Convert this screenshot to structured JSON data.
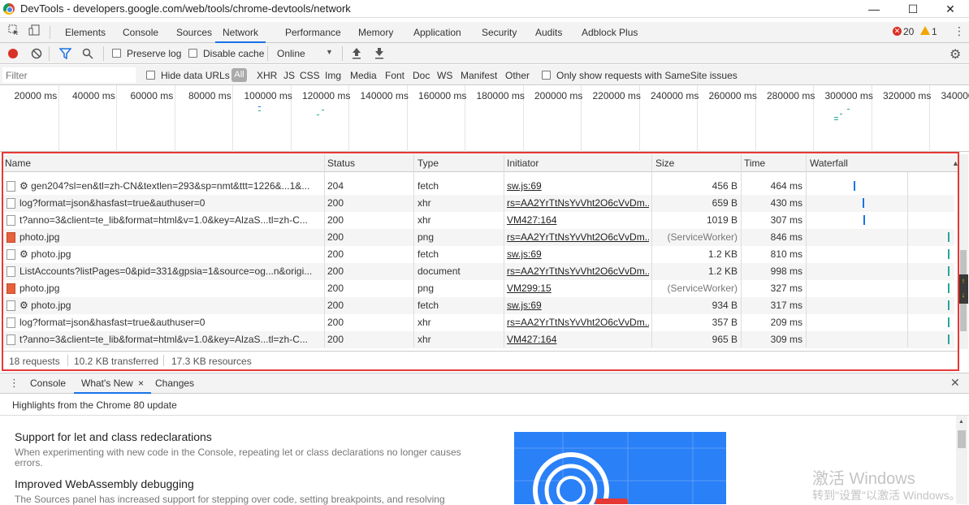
{
  "window": {
    "title": "DevTools - developers.google.com/web/tools/chrome-devtools/network",
    "minimize": "—",
    "maximize": "☐",
    "close": "✕"
  },
  "tabs": [
    "Elements",
    "Console",
    "Sources",
    "Network",
    "Performance",
    "Memory",
    "Application",
    "Security",
    "Audits",
    "Adblock Plus"
  ],
  "active_tab": "Network",
  "status": {
    "errors": "20",
    "warnings": "1"
  },
  "toolbar": {
    "preserve_log": "Preserve log",
    "disable_cache": "Disable cache",
    "throttle": "Online"
  },
  "filterbar": {
    "placeholder": "Filter",
    "hide_data_urls": "Hide data URLs",
    "all": "All",
    "types": [
      "XHR",
      "JS",
      "CSS",
      "Img",
      "Media",
      "Font",
      "Doc",
      "WS",
      "Manifest",
      "Other"
    ],
    "samesite": "Only show requests with SameSite issues"
  },
  "overview": {
    "ticks": [
      "20000 ms",
      "40000 ms",
      "60000 ms",
      "80000 ms",
      "100000 ms",
      "120000 ms",
      "140000 ms",
      "160000 ms",
      "180000 ms",
      "200000 ms",
      "220000 ms",
      "240000 ms",
      "260000 ms",
      "280000 ms",
      "300000 ms",
      "320000 ms",
      "340000"
    ]
  },
  "grid": {
    "columns": [
      "Name",
      "Status",
      "Type",
      "Initiator",
      "Size",
      "Time",
      "Waterfall"
    ],
    "rows": [
      {
        "name": "⚙ gen204?sl=en&tl=zh-CN&textlen=293&sp=nmt&ttt=1226&...1&...",
        "status": "204",
        "type": "fetch",
        "initiator": "sw.js:69",
        "size": "456 B",
        "time": "464 ms",
        "icon": "doc",
        "wf": 0.32
      },
      {
        "name": "log?format=json&hasfast=true&authuser=0",
        "status": "200",
        "type": "xhr",
        "initiator": "rs=AA2YrTtNsYvVht2O6cVvDm...",
        "size": "659 B",
        "time": "430 ms",
        "icon": "doc",
        "wf": 0.38
      },
      {
        "name": "t?anno=3&client=te_lib&format=html&v=1.0&key=AlzaS...tl=zh-C...",
        "status": "200",
        "type": "xhr",
        "initiator": "VM427:164",
        "size": "1019 B",
        "time": "307 ms",
        "icon": "doc",
        "wf": 0.39
      },
      {
        "name": "photo.jpg",
        "status": "200",
        "type": "png",
        "initiator": "rs=AA2YrTtNsYvVht2O6cVvDm...",
        "size": "(ServiceWorker)",
        "time": "846 ms",
        "icon": "img",
        "wf": 0.98
      },
      {
        "name": "⚙ photo.jpg",
        "status": "200",
        "type": "fetch",
        "initiator": "sw.js:69",
        "size": "1.2 KB",
        "time": "810 ms",
        "icon": "doc",
        "wf": 0.98
      },
      {
        "name": "ListAccounts?listPages=0&pid=331&gpsia=1&source=og...n&origi...",
        "status": "200",
        "type": "document",
        "initiator": "rs=AA2YrTtNsYvVht2O6cVvDm...",
        "size": "1.2 KB",
        "time": "998 ms",
        "icon": "doc",
        "wf": 0.98
      },
      {
        "name": "photo.jpg",
        "status": "200",
        "type": "png",
        "initiator": "VM299:15",
        "size": "(ServiceWorker)",
        "time": "327 ms",
        "icon": "img",
        "wf": 0.98
      },
      {
        "name": "⚙ photo.jpg",
        "status": "200",
        "type": "fetch",
        "initiator": "sw.js:69",
        "size": "934 B",
        "time": "317 ms",
        "icon": "doc",
        "wf": 0.98
      },
      {
        "name": "log?format=json&hasfast=true&authuser=0",
        "status": "200",
        "type": "xhr",
        "initiator": "rs=AA2YrTtNsYvVht2O6cVvDm...",
        "size": "357 B",
        "time": "209 ms",
        "icon": "doc",
        "wf": 0.98
      },
      {
        "name": "t?anno=3&client=te_lib&format=html&v=1.0&key=AlzaS...tl=zh-C...",
        "status": "200",
        "type": "xhr",
        "initiator": "VM427:164",
        "size": "965 B",
        "time": "309 ms",
        "icon": "doc",
        "wf": 0.98
      }
    ]
  },
  "summary": {
    "requests": "18 requests",
    "transferred": "10.2 KB transferred",
    "resources": "17.3 KB resources"
  },
  "drawer": {
    "tabs": [
      "Console",
      "What's New",
      "Changes"
    ],
    "active": "What's New",
    "close_tab": "×",
    "close": "✕"
  },
  "whatsnew": {
    "header": "Highlights from the Chrome 80 update",
    "items": [
      {
        "title": "Support for let and class redeclarations",
        "desc": "When experimenting with new code in the Console, repeating let or class declarations no longer causes errors."
      },
      {
        "title": "Improved WebAssembly debugging",
        "desc": "The Sources panel has increased support for stepping over code, setting breakpoints, and resolving"
      }
    ]
  },
  "watermark": {
    "line1": "激活 Windows",
    "line2": "转到\"设置\"以激活 Windows。"
  },
  "colors": {
    "accent": "#1a73e8",
    "highlight": "#e53935",
    "record": "#d93025"
  }
}
